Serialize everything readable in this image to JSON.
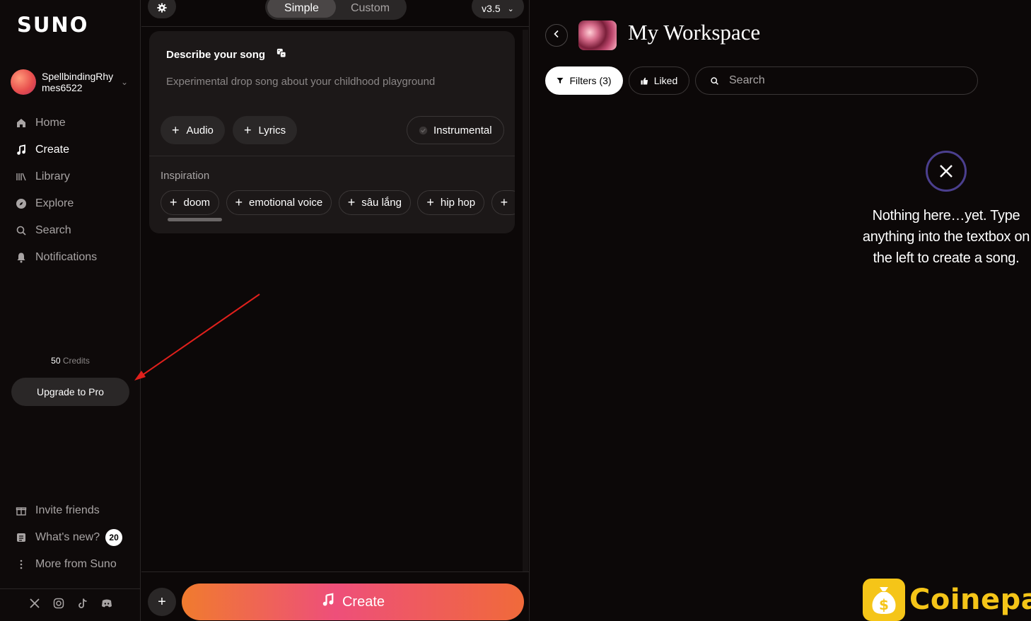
{
  "brand": {
    "logo": "SUNO"
  },
  "user": {
    "name_line1": "SpellbindingRhy",
    "name_line2": "mes6522"
  },
  "sidebar": {
    "items": [
      {
        "label": "Home",
        "icon": "home-icon"
      },
      {
        "label": "Create",
        "icon": "music-note-icon"
      },
      {
        "label": "Library",
        "icon": "library-icon"
      },
      {
        "label": "Explore",
        "icon": "compass-icon"
      },
      {
        "label": "Search",
        "icon": "search-icon"
      },
      {
        "label": "Notifications",
        "icon": "bell-icon"
      }
    ],
    "credits_value": "50",
    "credits_label": "Credits",
    "upgrade_label": "Upgrade to Pro",
    "bottom_items": [
      {
        "label": "Invite friends",
        "icon": "gift-icon"
      },
      {
        "label": "What's new?",
        "icon": "news-icon",
        "badge": "20"
      },
      {
        "label": "More from Suno",
        "icon": "more-icon"
      }
    ],
    "social": [
      "x-icon",
      "instagram-icon",
      "tiktok-icon",
      "discord-icon"
    ]
  },
  "composer": {
    "modes": [
      "Simple",
      "Custom"
    ],
    "active_mode": "Simple",
    "version": "v3.5",
    "describe_title": "Describe your song",
    "prompt_placeholder": "Experimental drop song about your childhood playground",
    "audio_label": "Audio",
    "lyrics_label": "Lyrics",
    "instrumental_label": "Instrumental",
    "inspiration_label": "Inspiration",
    "chips": [
      "doom",
      "emotional voice",
      "sâu lắng",
      "hip hop"
    ],
    "create_label": "Create"
  },
  "workspace": {
    "title": "My Workspace",
    "filters_label": "Filters (3)",
    "liked_label": "Liked",
    "search_placeholder": "Search",
    "empty_message": "Nothing here…yet. Type anything into the textbox on the left to create a song."
  },
  "watermark": {
    "text": "Coinepay"
  },
  "colors": {
    "accent_gradient_start": "#f07b2e",
    "accent_gradient_mid": "#ee4f7a",
    "empty_icon": "#4b3f8e",
    "watermark": "#f5c518",
    "annotation_arrow": "#e0201c"
  }
}
